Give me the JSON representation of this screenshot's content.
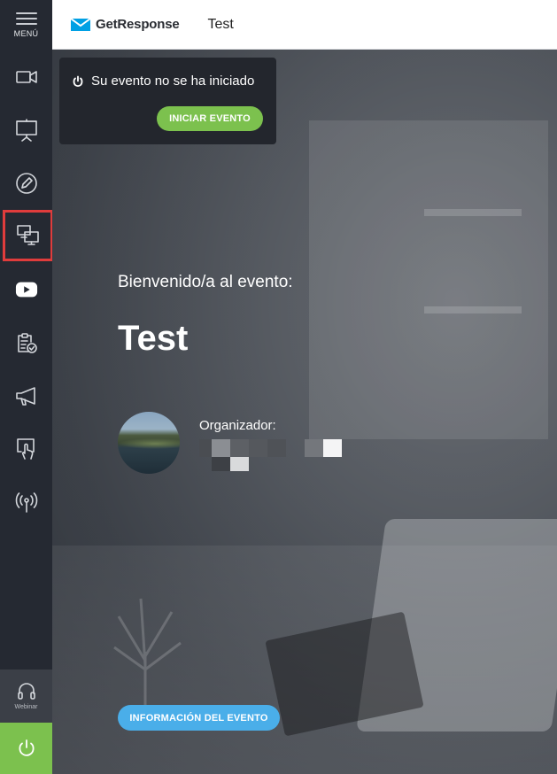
{
  "sidebar": {
    "menu_label": "MENÚ",
    "items": [
      {
        "icon": "video-camera-icon"
      },
      {
        "icon": "presentation-board-icon"
      },
      {
        "icon": "pencil-icon"
      },
      {
        "icon": "screen-share-icon",
        "active": true
      },
      {
        "icon": "youtube-icon"
      },
      {
        "icon": "clipboard-check-icon"
      },
      {
        "icon": "megaphone-icon"
      },
      {
        "icon": "touch-screen-icon"
      },
      {
        "icon": "broadcast-icon"
      }
    ],
    "webinar_label": "Webinar",
    "power_icon": "power-icon"
  },
  "header": {
    "brand": "GetResponse",
    "event_name": "Test"
  },
  "notice": {
    "text": "Su evento no se ha iniciado",
    "start_button": "INICIAR EVENTO"
  },
  "main": {
    "welcome": "Bienvenido/a al evento:",
    "title": "Test",
    "organizer_label": "Organizador:",
    "info_button": "INFORMACIÓN DEL EVENTO"
  },
  "colors": {
    "accent_green": "#7cc14e",
    "accent_blue": "#4aaee9",
    "sidebar_bg": "#252932",
    "active_outline": "#e03c3c"
  }
}
